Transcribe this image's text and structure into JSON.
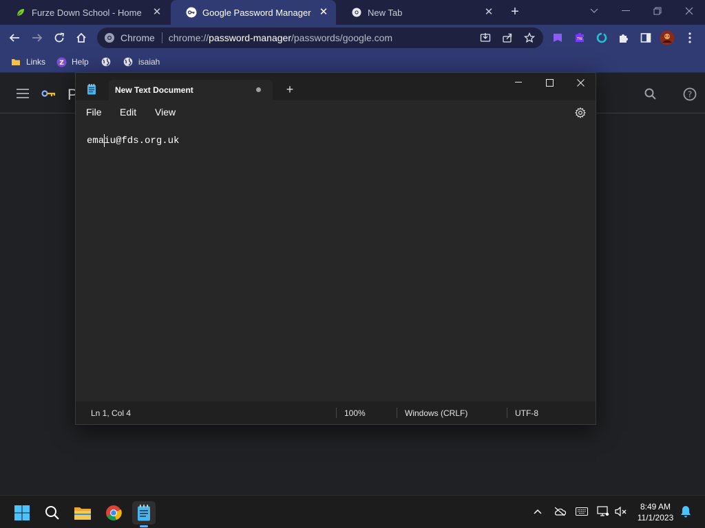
{
  "browser": {
    "tabs": [
      {
        "title": "Furze Down School - Home",
        "icon": "leaf-icon",
        "active": false
      },
      {
        "title": "Google Password Manager",
        "icon": "password-manager-key-icon",
        "active": true
      },
      {
        "title": "New Tab",
        "icon": "chrome-icon",
        "active": false
      }
    ],
    "tab_close_glyph": "✕",
    "new_tab_glyph": "+",
    "omnibox": {
      "chip_label": "Chrome",
      "url_prefix": "chrome://",
      "url_host": "password-manager",
      "url_path": "/passwords/google.com"
    },
    "bookmarks": [
      {
        "label": "Links",
        "icon": "folder-icon"
      },
      {
        "label": "Help",
        "icon": "help-z-icon"
      },
      {
        "label": "",
        "icon": "globe-icon"
      },
      {
        "label": "isaiah",
        "icon": "globe-icon"
      }
    ],
    "page_title_partial": "P"
  },
  "notepad": {
    "tab_title": "New Text Document",
    "menu": [
      "File",
      "Edit",
      "View"
    ],
    "content": "emaiu@fds.org.uk",
    "status": {
      "position": "Ln 1, Col 4",
      "zoom": "100%",
      "line_ending": "Windows (CRLF)",
      "encoding": "UTF-8"
    }
  },
  "taskbar": {
    "time": "8:49 AM",
    "date": "11/1/2023"
  },
  "colors": {
    "tabstrip": "#1e2240",
    "toolbar": "#303a73",
    "notepad_bg": "#272727",
    "accent": "#5fb2f2"
  }
}
